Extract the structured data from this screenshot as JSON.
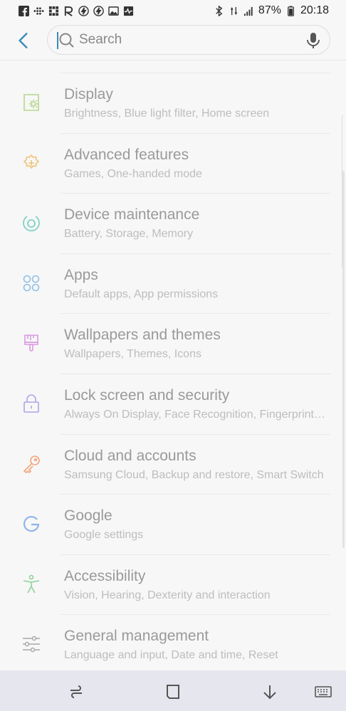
{
  "status_bar": {
    "battery": "87%",
    "time": "20:18",
    "left_icons": [
      "facebook-icon",
      "dots-grid-icon",
      "grid-icon",
      "r-icon",
      "flash-icon",
      "flash-icon",
      "image-icon",
      "pulse-icon"
    ],
    "right_icons": [
      "bluetooth-icon",
      "data-icon",
      "signal-icon"
    ]
  },
  "search": {
    "placeholder": "Search"
  },
  "items": [
    {
      "title": "Display",
      "subtitle": "Brightness, Blue light filter, Home screen",
      "icon": "display-icon",
      "color": "#b7d58a"
    },
    {
      "title": "Advanced features",
      "subtitle": "Games, One-handed mode",
      "icon": "gear-plus-icon",
      "color": "#f0c27a"
    },
    {
      "title": "Device maintenance",
      "subtitle": "Battery, Storage, Memory",
      "icon": "maintenance-icon",
      "color": "#7fd3c5"
    },
    {
      "title": "Apps",
      "subtitle": "Default apps, App permissions",
      "icon": "apps-icon",
      "color": "#8ec0e8"
    },
    {
      "title": "Wallpapers and themes",
      "subtitle": "Wallpapers, Themes, Icons",
      "icon": "brush-icon",
      "color": "#d99be0"
    },
    {
      "title": "Lock screen and security",
      "subtitle": "Always On Display, Face Recognition, Fingerprint scanner",
      "icon": "lock-icon",
      "color": "#b1a4e8"
    },
    {
      "title": "Cloud and accounts",
      "subtitle": "Samsung Cloud, Backup and restore, Smart Switch",
      "icon": "key-icon",
      "color": "#f2a57b"
    },
    {
      "title": "Google",
      "subtitle": "Google settings",
      "icon": "google-icon",
      "color": "#8fb5ec"
    },
    {
      "title": "Accessibility",
      "subtitle": "Vision, Hearing, Dexterity and interaction",
      "icon": "accessibility-icon",
      "color": "#8fd39a"
    },
    {
      "title": "General management",
      "subtitle": "Language and input, Date and time, Reset",
      "icon": "sliders-icon",
      "color": "#a9a9a9"
    }
  ],
  "nav": [
    "recents-icon",
    "home-icon",
    "hide-keyboard-icon",
    "keyboard-icon"
  ]
}
